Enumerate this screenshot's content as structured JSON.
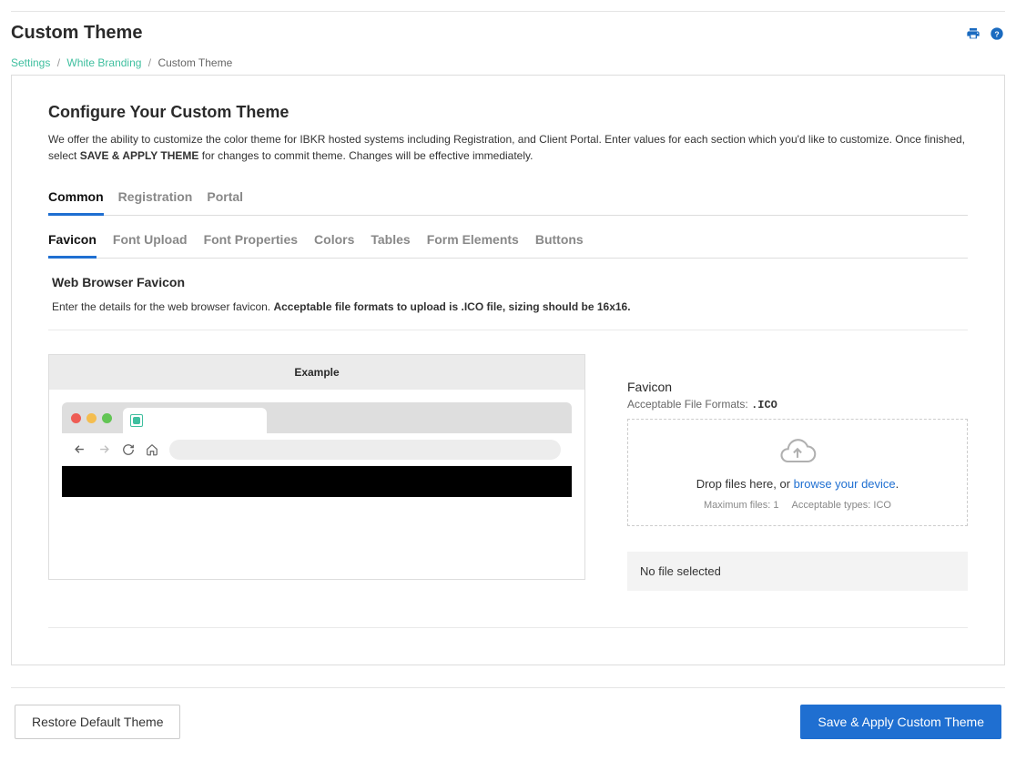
{
  "page": {
    "title": "Custom Theme"
  },
  "breadcrumb": {
    "items": [
      "Settings",
      "White Branding"
    ],
    "current": "Custom Theme"
  },
  "panel": {
    "heading": "Configure Your Custom Theme",
    "intro_prefix": "We offer the ability to customize the color theme for IBKR hosted systems including Registration, and Client Portal. Enter values for each section which you'd like to customize. Once finished, select ",
    "intro_bold": "SAVE & APPLY THEME",
    "intro_suffix": " for changes to commit theme. Changes will be effective immediately."
  },
  "tabs_primary": {
    "items": [
      "Common",
      "Registration",
      "Portal"
    ],
    "active_index": 0
  },
  "tabs_secondary": {
    "items": [
      "Favicon",
      "Font Upload",
      "Font Properties",
      "Colors",
      "Tables",
      "Form Elements",
      "Buttons"
    ],
    "active_index": 0
  },
  "favicon_section": {
    "title": "Web Browser Favicon",
    "desc_prefix": "Enter the details for the web browser favicon. ",
    "desc_bold": "Acceptable file formats to upload is .ICO file, sizing should be 16x16.",
    "example_label": "Example"
  },
  "upload": {
    "label": "Favicon",
    "formats_prefix": "Acceptable File Formats: ",
    "formats_value": ".ICO",
    "drop_prefix": "Drop files here, or ",
    "drop_link": "browse your device",
    "drop_suffix": ".",
    "max_files": "Maximum files: 1",
    "acceptable_types": "Acceptable types: ICO",
    "no_file": "No file selected"
  },
  "footer": {
    "restore": "Restore Default Theme",
    "save": "Save & Apply Custom Theme"
  }
}
